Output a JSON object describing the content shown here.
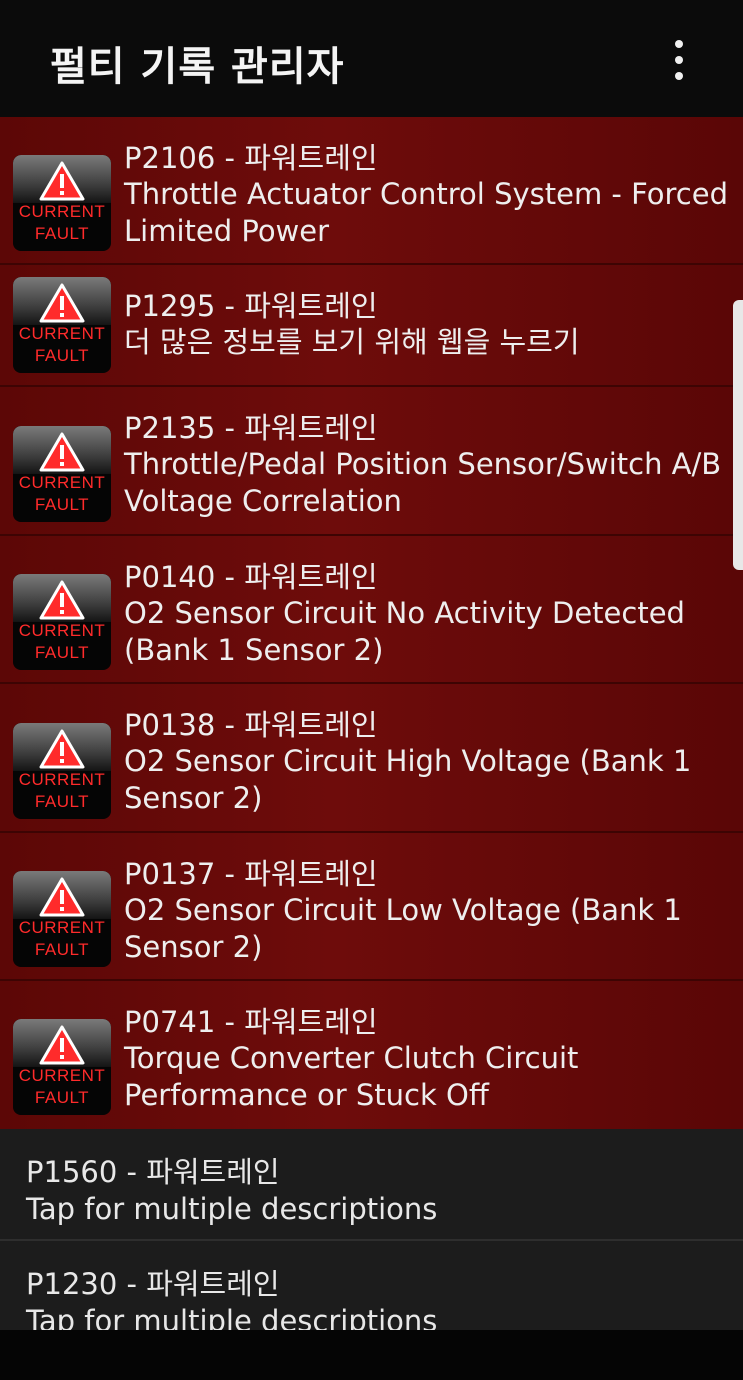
{
  "app_bar": {
    "title": "펄티 기록 관리자",
    "menu_icon": "more-vert-icon"
  },
  "badge": {
    "line1": "CURRENT",
    "line2": "FAULT",
    "icon": "warning-triangle-icon",
    "text_color": "#ff2b2b"
  },
  "colors": {
    "fault_row_bg": "#6e0c0b",
    "plain_row_bg": "#1c1c1c",
    "app_bar_bg": "#0b0b0b"
  },
  "faults": [
    {
      "code": "P2106 - 파워트레인",
      "description": "Throttle Actuator Control System - Forced Limited Power"
    },
    {
      "code": "P1295 - 파워트레인",
      "description": "더 많은 정보를 보기 위해 웹을 누르기"
    },
    {
      "code": "P2135 - 파워트레인",
      "description": "Throttle/Pedal Position Sensor/Switch A/B Voltage Correlation"
    },
    {
      "code": "P0140 - 파워트레인",
      "description": "O2 Sensor Circuit No Activity Detected (Bank 1 Sensor 2)"
    },
    {
      "code": "P0138 - 파워트레인",
      "description": "O2 Sensor Circuit High Voltage (Bank 1 Sensor 2)"
    },
    {
      "code": "P0137 - 파워트레인",
      "description": "O2 Sensor Circuit Low Voltage (Bank 1 Sensor 2)"
    },
    {
      "code": "P0741 - 파워트레인",
      "description": "Torque Converter Clutch Circuit Performance or Stuck Off"
    }
  ],
  "other_codes": [
    {
      "code": "P1560 - 파워트레인",
      "description": "Tap for multiple descriptions"
    },
    {
      "code": "P1230 - 파워트레인",
      "description": "Tap for multiple descriptions"
    }
  ]
}
